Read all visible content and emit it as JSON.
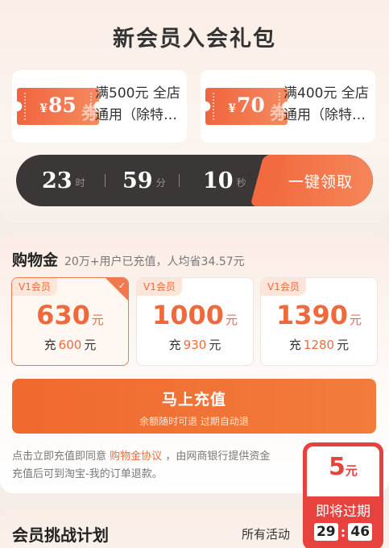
{
  "gift": {
    "title": "新会员入会礼包",
    "coupons": [
      {
        "currency": "¥",
        "amount": "85",
        "watermark": "券",
        "line1": "满500元 全店",
        "line2": "通用（除特…"
      },
      {
        "currency": "¥",
        "amount": "70",
        "watermark": "券",
        "line1": "满400元 全店",
        "line2": "通用（除特…"
      }
    ],
    "timer": {
      "hours": "23",
      "hours_unit": "时",
      "minutes": "59",
      "minutes_unit": "分",
      "seconds": "10",
      "seconds_unit": "秒"
    },
    "claim_label": "一键领取"
  },
  "money": {
    "title": "购物金",
    "subtitle": "20万+用户已充值，人均省34.57元",
    "tiers": [
      {
        "badge": "V1会员",
        "amount": "630",
        "unit": "元",
        "pay_prefix": "充",
        "pay": "600",
        "pay_unit": "元",
        "selected": true
      },
      {
        "badge": "V1会员",
        "amount": "1000",
        "unit": "元",
        "pay_prefix": "充",
        "pay": "930",
        "pay_unit": "元",
        "selected": false
      },
      {
        "badge": "V1会员",
        "amount": "1390",
        "unit": "元",
        "pay_prefix": "充",
        "pay": "1280",
        "pay_unit": "元",
        "selected": false
      }
    ],
    "topup_label": "马上充值",
    "topup_sub": "余额随时可退 过期自动退",
    "terms_prefix": "点击立即充值即同意",
    "terms_link": "购物金协议",
    "terms_suffix": "，由网商银行提供资金",
    "terms_line2": "充值后可到淘宝-我的订单退款。"
  },
  "challenge": {
    "title": "会员挑战计划",
    "link": "所有活动"
  },
  "floating": {
    "amount": "5",
    "unit": "元",
    "label": "即将过期",
    "minutes": "29",
    "seconds": "46"
  },
  "colors": {
    "accent": "#ee6a3c",
    "button": "#f0692f",
    "timer_bg": "#3b3736",
    "float_red": "#e8423e"
  }
}
